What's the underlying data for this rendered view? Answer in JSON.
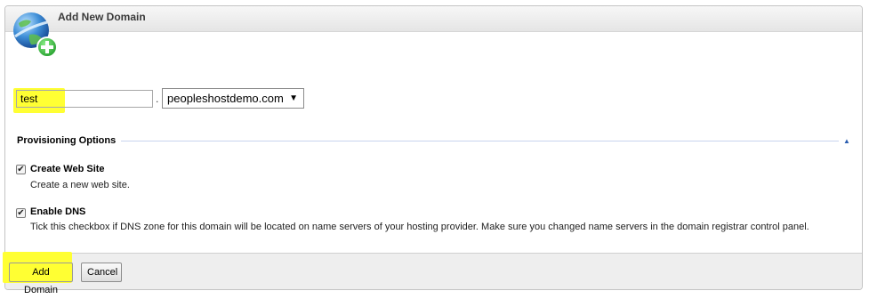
{
  "panel": {
    "title": "Add New Domain",
    "icon": "globe-add-icon"
  },
  "form": {
    "domain_name_value": "test",
    "separator": ".",
    "parent_domain_selected": "peopleshostdemo.com"
  },
  "provisioning": {
    "title": "Provisioning Options",
    "options": [
      {
        "label": "Create Web Site",
        "description": "Create a new web site.",
        "checked": true
      },
      {
        "label": "Enable DNS",
        "description": "Tick this checkbox if DNS zone for this domain will be located on name servers of your hosting provider. Make sure you changed name servers in the domain registrar control panel.",
        "checked": true
      }
    ]
  },
  "footer": {
    "add_label": "Add Domain",
    "cancel_label": "Cancel"
  },
  "colors": {
    "highlight": "#ffff33",
    "accent": "#2a5db0"
  }
}
